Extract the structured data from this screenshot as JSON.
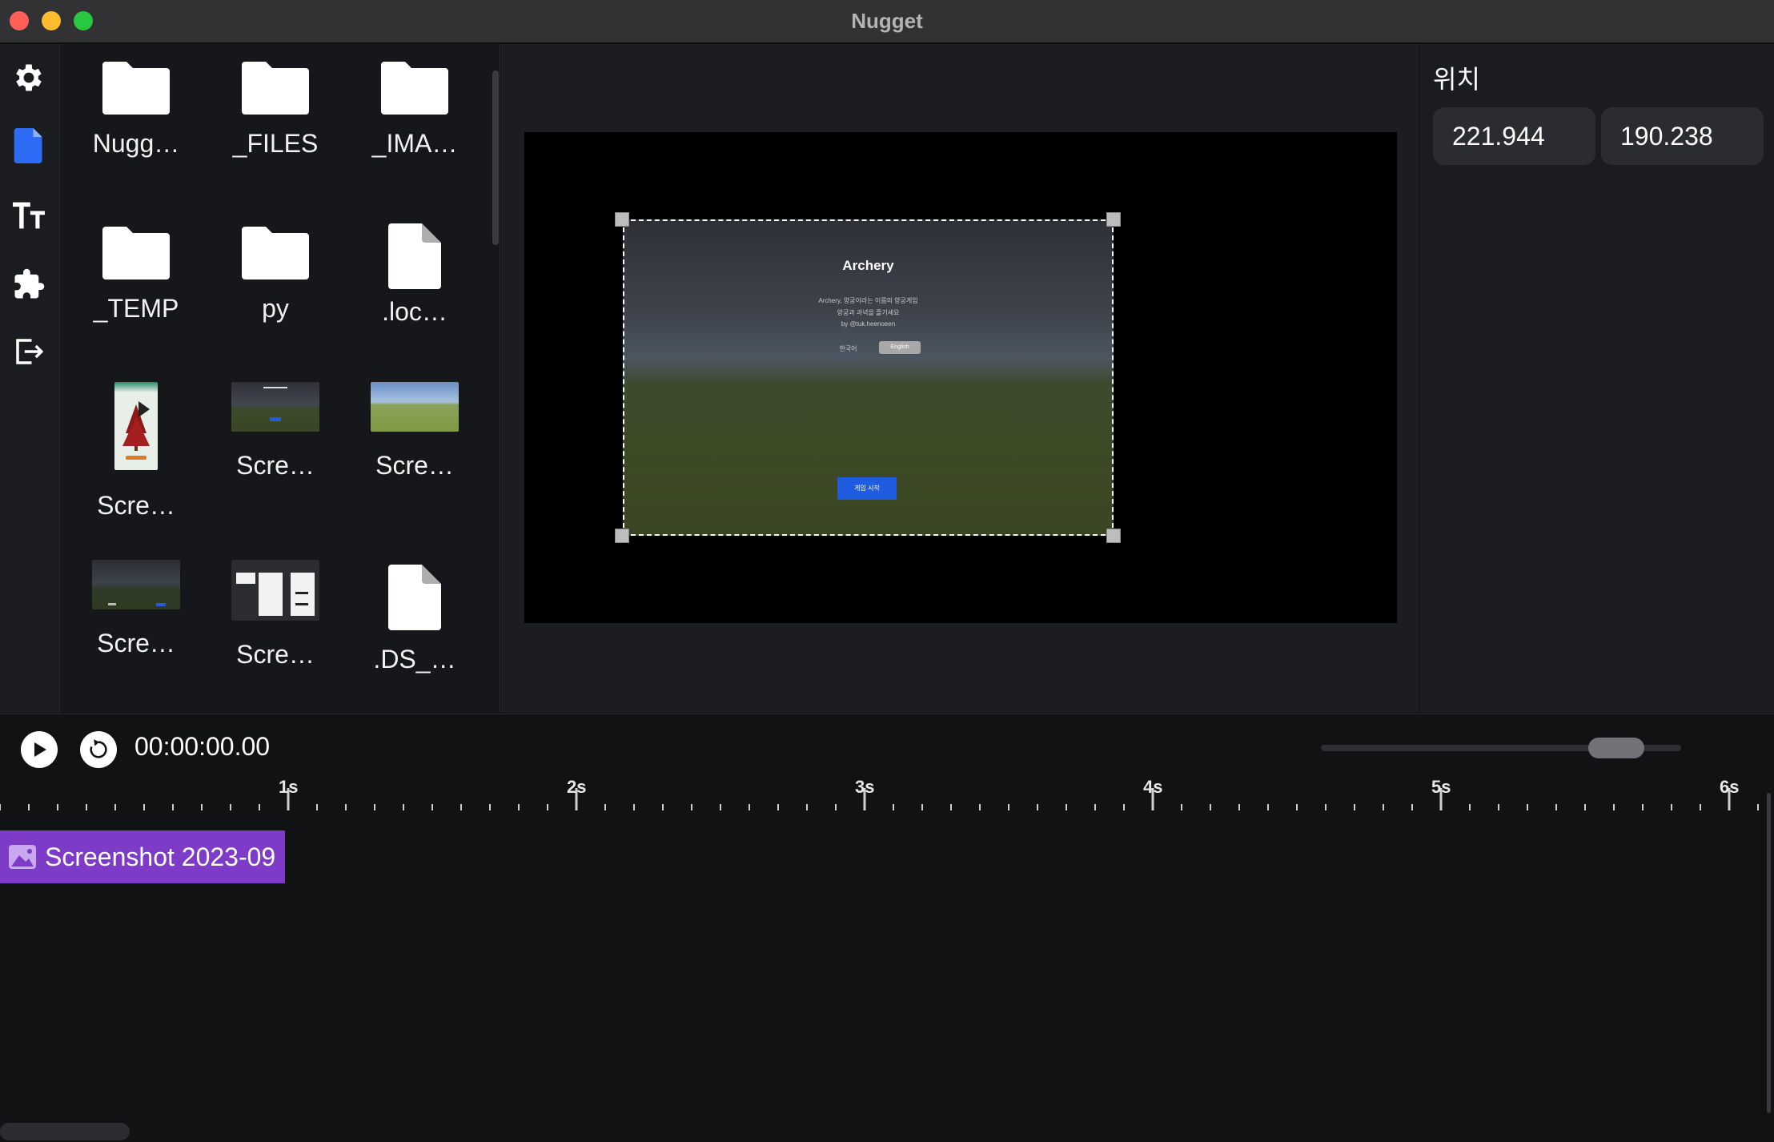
{
  "window": {
    "title": "Nugget"
  },
  "sidebar": {
    "items": [
      {
        "icon": "gear-icon",
        "active": false
      },
      {
        "icon": "file-icon",
        "active": true
      },
      {
        "icon": "text-icon",
        "active": false
      },
      {
        "icon": "puzzle-icon",
        "active": false
      },
      {
        "icon": "export-icon",
        "active": false
      }
    ],
    "accent": "#2f6cf6"
  },
  "files": {
    "items": [
      {
        "label": "Nugg…",
        "kind": "folder"
      },
      {
        "label": "_FILES",
        "kind": "folder"
      },
      {
        "label": "_IMA…",
        "kind": "folder"
      },
      {
        "label": "_TEMP",
        "kind": "folder"
      },
      {
        "label": "py",
        "kind": "folder"
      },
      {
        "label": ".loc…",
        "kind": "file"
      },
      {
        "label": "Scre…",
        "kind": "image"
      },
      {
        "label": "Scre…",
        "kind": "image"
      },
      {
        "label": "Scre…",
        "kind": "image"
      },
      {
        "label": "Scre…",
        "kind": "image"
      },
      {
        "label": "Scre…",
        "kind": "image"
      },
      {
        "label": ".DS_…",
        "kind": "file"
      }
    ]
  },
  "preview": {
    "title": "Archery",
    "line1": "Archery, 양궁이라는 이름의 양궁게임",
    "line2": "양궁과 과녁을 즐기세요",
    "line3": "by @tuk.heenoeen",
    "lang_left": "한국어",
    "lang_right": "English",
    "start": "게임 시작"
  },
  "properties": {
    "title": "위치",
    "x": "221.944",
    "y": "190.238"
  },
  "timeline": {
    "timecode": "00:00:00.00",
    "zoom_level": 0.88,
    "ticks": [
      "1s",
      "2s",
      "3s",
      "4s",
      "5s",
      "6s"
    ],
    "clip_label": "Screenshot 2023-09",
    "clip_color": "#7e3bc7"
  }
}
